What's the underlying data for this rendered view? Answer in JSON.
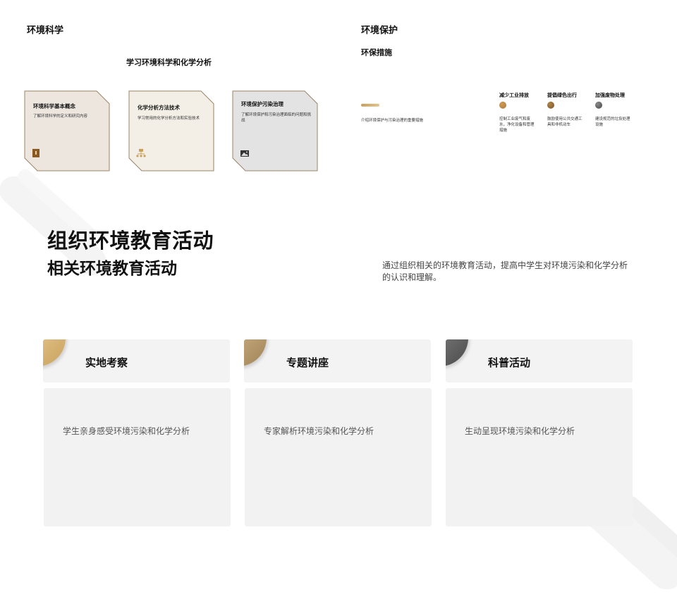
{
  "slide_left": {
    "heading": "环境科学",
    "subtitle": "学习环境科学和化学分析",
    "cards": [
      {
        "title": "环境科学基本概念",
        "desc": "了解环境科学的定义和研究内容",
        "icon": "document-icon"
      },
      {
        "title": "化学分析方法技术",
        "desc": "学习常用的化学分析方法和实验技术",
        "icon": "hierarchy-icon"
      },
      {
        "title": "环境保护污染治理",
        "desc": "了解环境保护和污染治理面临的问题和挑战",
        "icon": "image-icon"
      }
    ]
  },
  "slide_right": {
    "heading": "环境保护",
    "subheading": "环保措施",
    "intro": "介绍环境保护与污染治理的重要措施",
    "measures": [
      {
        "title": "减少工业排放",
        "desc": "控制工业废气和废水，净化设备和管理措施",
        "color": "#a87a3c"
      },
      {
        "title": "提倡绿色出行",
        "desc": "鼓励使用公共交通工具和非机动车",
        "color": "#8a6230"
      },
      {
        "title": "加强废物处理",
        "desc": "建设规范的垃圾处理设施",
        "color": "#555555"
      }
    ]
  },
  "slide_bottom": {
    "title": "组织环境教育活动",
    "subtitle": "相关环境教育活动",
    "lead": "通过组织相关的环境教育活动，提高中学生对环境污染和化学分析的认识和理解。",
    "activities": [
      {
        "title": "实地考察",
        "desc": "学生亲身感受环境污染和化学分析",
        "color": "#d4b06a"
      },
      {
        "title": "专题讲座",
        "desc": "专家解析环境污染和化学分析",
        "color": "#b09468"
      },
      {
        "title": "科普活动",
        "desc": "生动呈现环境污染和化学分析",
        "color": "#5a5a5a"
      }
    ]
  },
  "colors": {
    "card1_fill": "#ece6df",
    "card2_fill": "#f3eee6",
    "card3_fill": "#e3e3e3",
    "card_border": "#9a8466",
    "accent": "#c9a15b"
  }
}
